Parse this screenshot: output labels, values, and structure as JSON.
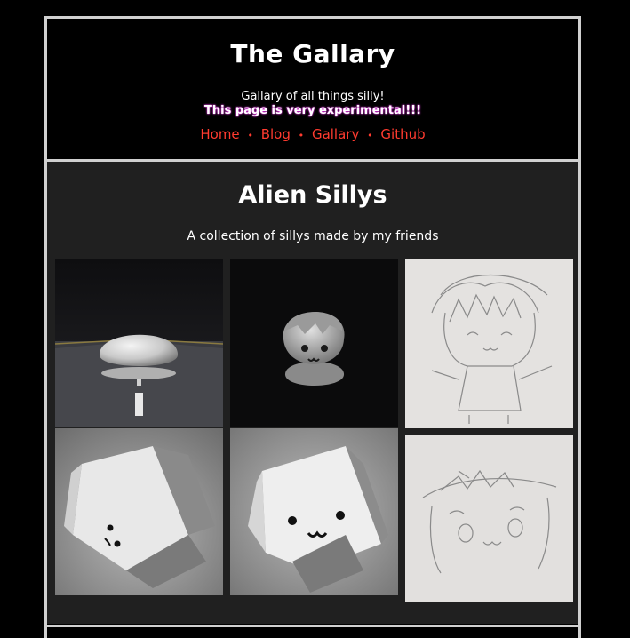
{
  "header": {
    "title": "The Gallary",
    "tagline": "Gallary of all things silly!",
    "warning": "This page is very experimental!!!"
  },
  "nav": {
    "items": [
      {
        "label": "Home"
      },
      {
        "label": "Blog"
      },
      {
        "label": "Gallary"
      },
      {
        "label": "Github"
      }
    ],
    "separator": "•"
  },
  "section": {
    "title": "Alien Sillys",
    "description": "A collection of sillys made by my friends"
  },
  "colors": {
    "background": "#000000",
    "panel": "#202020",
    "border": "#d0d0d0",
    "link": "#ff3b2f",
    "warning_glow": "#ff40ff"
  },
  "gallery": {
    "images": [
      {
        "name": "blob-on-road-render"
      },
      {
        "name": "bust-face-render"
      },
      {
        "name": "pencil-chibi-sketch"
      },
      {
        "name": "paper-cube-tilted"
      },
      {
        "name": "paper-cube-face"
      },
      {
        "name": "pencil-owo-sketch"
      }
    ]
  }
}
